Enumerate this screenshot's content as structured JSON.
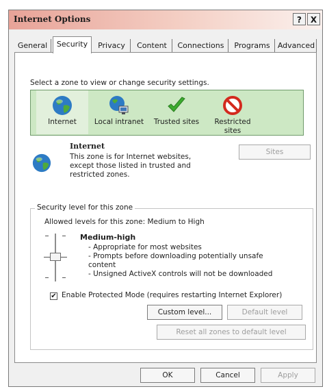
{
  "window": {
    "title": "Internet Options",
    "help_label": "?",
    "close_label": "X"
  },
  "tabs": [
    {
      "label": "General"
    },
    {
      "label": "Security"
    },
    {
      "label": "Privacy"
    },
    {
      "label": "Content"
    },
    {
      "label": "Connections"
    },
    {
      "label": "Programs"
    },
    {
      "label": "Advanced"
    }
  ],
  "security": {
    "select_zone_text": "Select a zone to view or change security settings.",
    "zones": [
      {
        "label": "Internet",
        "icon": "globe-icon"
      },
      {
        "label": "Local intranet",
        "icon": "network-globe-icon"
      },
      {
        "label": "Trusted sites",
        "icon": "checkmark-icon"
      },
      {
        "label": "Restricted sites",
        "icon": "prohibited-icon"
      }
    ],
    "selected_zone": {
      "name": "Internet",
      "description_lines": [
        "This zone is for Internet websites,",
        "except those listed in trusted and",
        "restricted zones."
      ],
      "sites_button": "Sites"
    },
    "level_group": {
      "title": "Security level for this zone",
      "allowed_levels": "Allowed levels for this zone: Medium to High",
      "level_name": "Medium-high",
      "level_details": [
        "- Appropriate for most websites",
        "- Prompts before downloading potentially unsafe",
        "content",
        "- Unsigned ActiveX controls will not be downloaded"
      ],
      "protected_mode_label": "Enable Protected Mode (requires restarting Internet Explorer)",
      "protected_mode_checked": true,
      "custom_level_button": "Custom level...",
      "default_level_button": "Default level"
    },
    "reset_all_button": "Reset all zones to default level"
  },
  "footer": {
    "ok": "OK",
    "cancel": "Cancel",
    "apply": "Apply"
  },
  "colors": {
    "title_gradient_start": "#e8a398",
    "zone_band": "#cde8c4",
    "disabled_text": "#9d9d9d"
  }
}
